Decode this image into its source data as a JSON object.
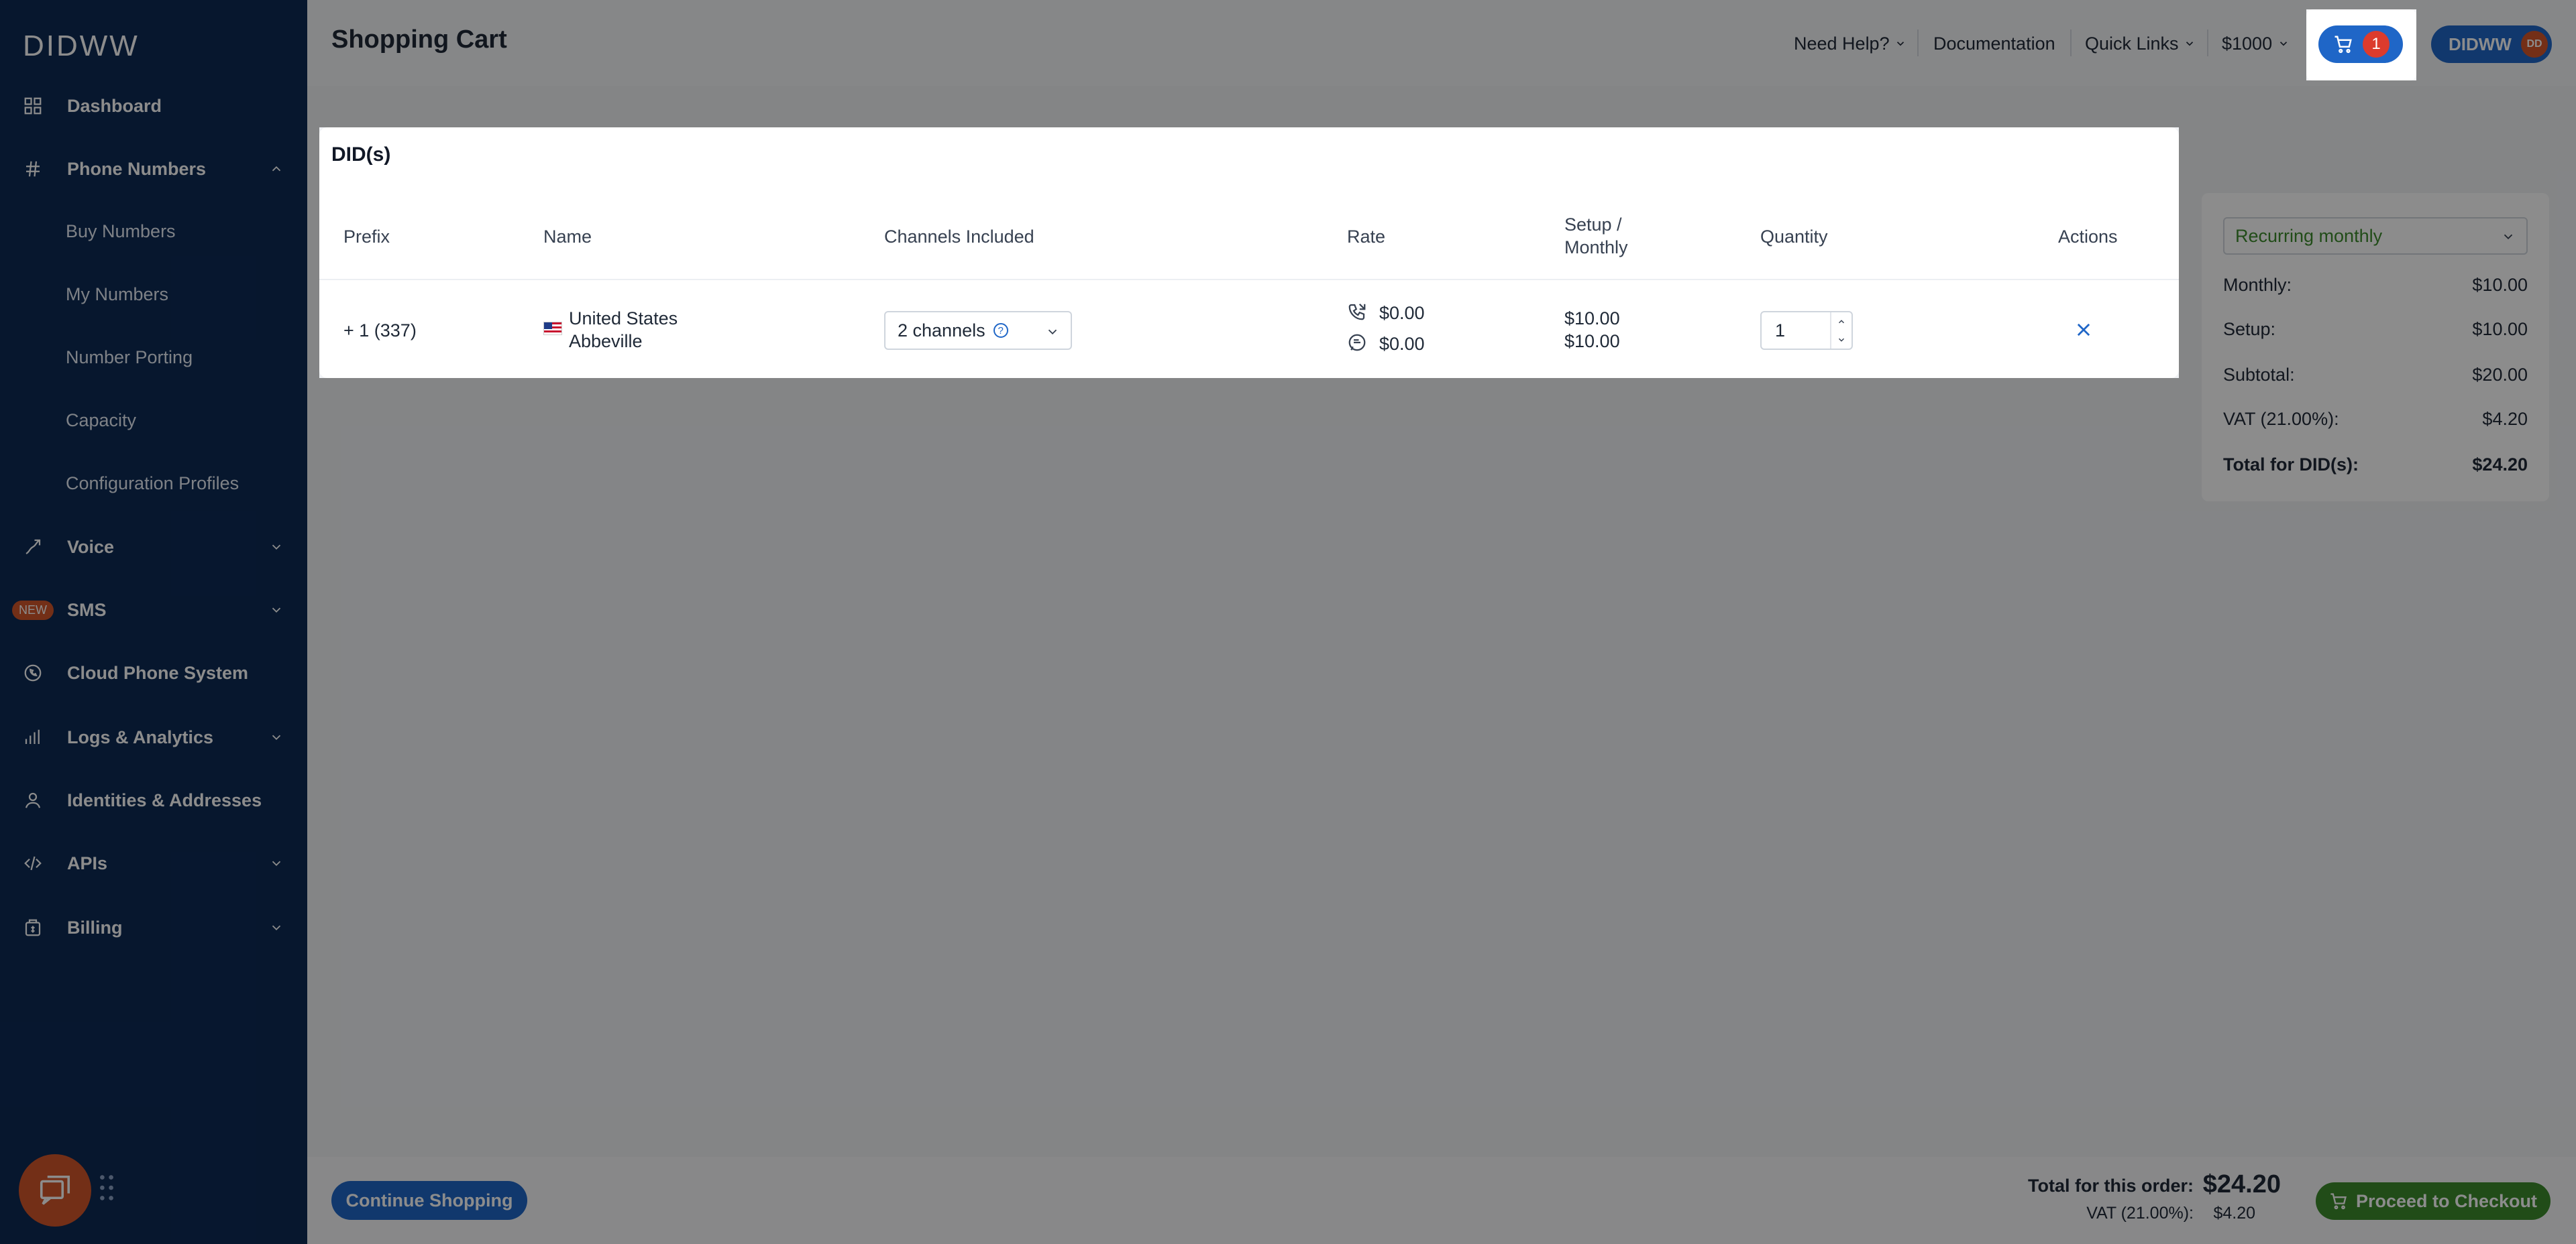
{
  "sidebar": {
    "logo": "DIDWW",
    "items": [
      {
        "label": "Dashboard",
        "icon": "grid-icon"
      },
      {
        "label": "Phone Numbers",
        "icon": "hash-icon"
      },
      {
        "label": "Voice",
        "icon": "voice-icon"
      },
      {
        "label": "SMS",
        "icon": "sms-icon",
        "badge": "NEW"
      },
      {
        "label": "Cloud Phone System",
        "icon": "phone-circle-icon"
      },
      {
        "label": "Logs & Analytics",
        "icon": "bar-chart-icon"
      },
      {
        "label": "Identities & Addresses",
        "icon": "user-icon"
      },
      {
        "label": "APIs",
        "icon": "code-icon"
      },
      {
        "label": "Billing",
        "icon": "billing-icon"
      }
    ],
    "sub_items": [
      "Buy Numbers",
      "My Numbers",
      "Number Porting",
      "Capacity",
      "Configuration Profiles"
    ]
  },
  "header": {
    "title": "Shopping Cart",
    "need_help": "Need Help?",
    "documentation": "Documentation",
    "quick_links": "Quick Links",
    "balance": "$1000",
    "cart_count": "1",
    "user_name": "DIDWW",
    "user_initials": "DD"
  },
  "did_table": {
    "title": "DID(s)",
    "columns": {
      "prefix": "Prefix",
      "name": "Name",
      "channels": "Channels Included",
      "rate": "Rate",
      "setup_line1": "Setup /",
      "setup_line2": "Monthly",
      "quantity": "Quantity",
      "actions": "Actions"
    },
    "row": {
      "prefix": "+ 1 (337)",
      "country": "United States",
      "city": "Abbeville",
      "channels": "2 channels",
      "rate_voice": "$0.00",
      "rate_sms": "$0.00",
      "setup": "$10.00",
      "monthly": "$10.00",
      "quantity": "1"
    }
  },
  "summary": {
    "billing_period": "Recurring monthly",
    "rows": [
      {
        "label": "Monthly:",
        "value": "$10.00"
      },
      {
        "label": "Setup:",
        "value": "$10.00"
      },
      {
        "label": "Subtotal:",
        "value": "$20.00"
      },
      {
        "label": "VAT (21.00%):",
        "value": "$4.20"
      },
      {
        "label": "Total for DID(s):",
        "value": "$24.20"
      }
    ]
  },
  "footer": {
    "continue_label": "Continue Shopping",
    "order_total_label": "Total for this order:",
    "order_total_value": "$24.20",
    "vat_label": "VAT (21.00%):",
    "vat_value": "$4.20",
    "checkout_label": "Proceed to Checkout"
  },
  "colors": {
    "sidebar": "#0d2a55",
    "primary": "#1f66c7",
    "accent_orange": "#d2562a",
    "success": "#3d8b2c",
    "cart_badge": "#dc3b2d"
  }
}
